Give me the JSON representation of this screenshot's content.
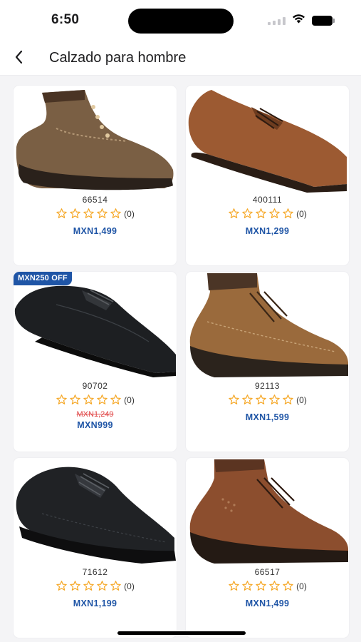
{
  "status_bar": {
    "time": "6:50"
  },
  "header": {
    "title": "Calzado para hombre"
  },
  "colors": {
    "accent": "#1f55a6",
    "old_price": "#e04848",
    "star": "#f5a623"
  },
  "products": [
    {
      "sku": "66514",
      "rating_count": "(0)",
      "price": "MXN1,499",
      "image": "brown-hiking-boot"
    },
    {
      "sku": "400111",
      "rating_count": "(0)",
      "price": "MXN1,299",
      "image": "tan-oxford-shoe"
    },
    {
      "sku": "90702",
      "rating_count": "(0)",
      "badge": "MXN250 OFF",
      "old_price": "MXN1,249",
      "price": "MXN999",
      "image": "black-dress-shoe"
    },
    {
      "sku": "92113",
      "rating_count": "(0)",
      "price": "MXN1,599",
      "image": "tan-work-boot"
    },
    {
      "sku": "71612",
      "rating_count": "(0)",
      "price": "MXN1,199",
      "image": "black-casual-shoe"
    },
    {
      "sku": "66517",
      "rating_count": "(0)",
      "price": "MXN1,499",
      "image": "cognac-boot"
    }
  ]
}
